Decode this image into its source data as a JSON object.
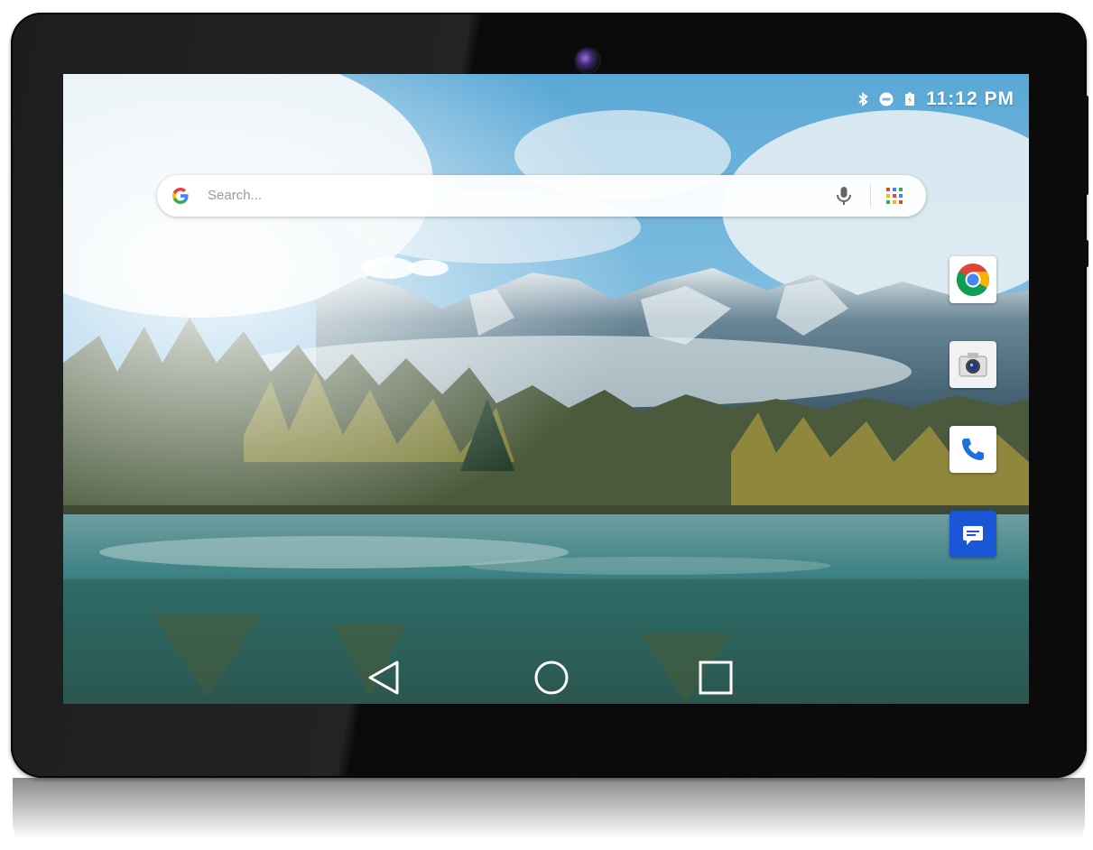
{
  "status_bar": {
    "time": "11:12 PM",
    "icons": [
      "bluetooth-icon",
      "do-not-disturb-icon",
      "battery-charging-icon"
    ]
  },
  "search": {
    "placeholder": "Search...",
    "logo": "google-g-icon",
    "voice_icon": "microphone-icon",
    "apps_icon": "app-grid-icon"
  },
  "dock": {
    "apps": [
      {
        "name": "Chrome",
        "icon": "chrome-icon"
      },
      {
        "name": "Camera",
        "icon": "camera-icon"
      },
      {
        "name": "Phone",
        "icon": "phone-icon"
      },
      {
        "name": "Messages",
        "icon": "messages-icon"
      }
    ]
  },
  "navigation": {
    "buttons": [
      {
        "name": "Back",
        "icon": "back-triangle-icon"
      },
      {
        "name": "Home",
        "icon": "home-circle-icon"
      },
      {
        "name": "Recents",
        "icon": "recents-square-icon"
      }
    ]
  },
  "colors": {
    "bezel": "#121212",
    "messages_app": "#1a57d6",
    "phone_blue": "#1e6fe0",
    "google_blue": "#4285F4",
    "google_red": "#EA4335",
    "google_yellow": "#FBBC05",
    "google_green": "#34A853"
  }
}
